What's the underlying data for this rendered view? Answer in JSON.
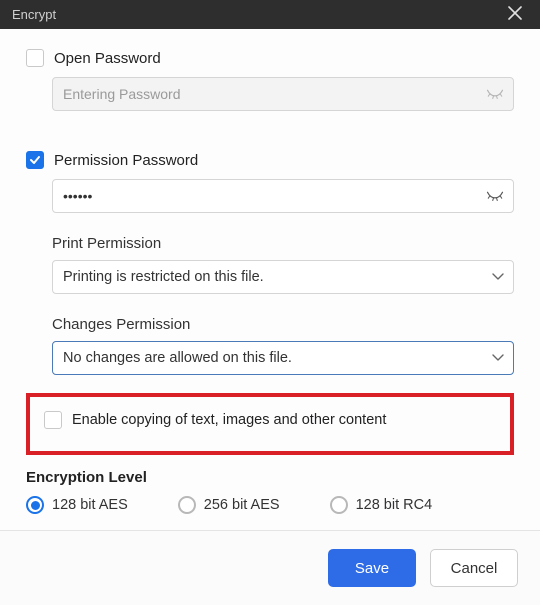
{
  "title": "Encrypt",
  "open_password_label": "Open Password",
  "open_password_placeholder": "Entering Password",
  "permission_password_label": "Permission Password",
  "permission_password_value": "••••••",
  "print_permission_label": "Print Permission",
  "print_permission_value": "Printing is restricted on this file.",
  "changes_permission_label": "Changes Permission",
  "changes_permission_value": "No changes are allowed on this file.",
  "enable_copy_label": "Enable copying of text, images and other content",
  "encryption_level_label": "Encryption Level",
  "radio_128aes": "128 bit AES",
  "radio_256aes": "256 bit AES",
  "radio_128rc4": "128 bit RC4",
  "save_label": "Save",
  "cancel_label": "Cancel"
}
